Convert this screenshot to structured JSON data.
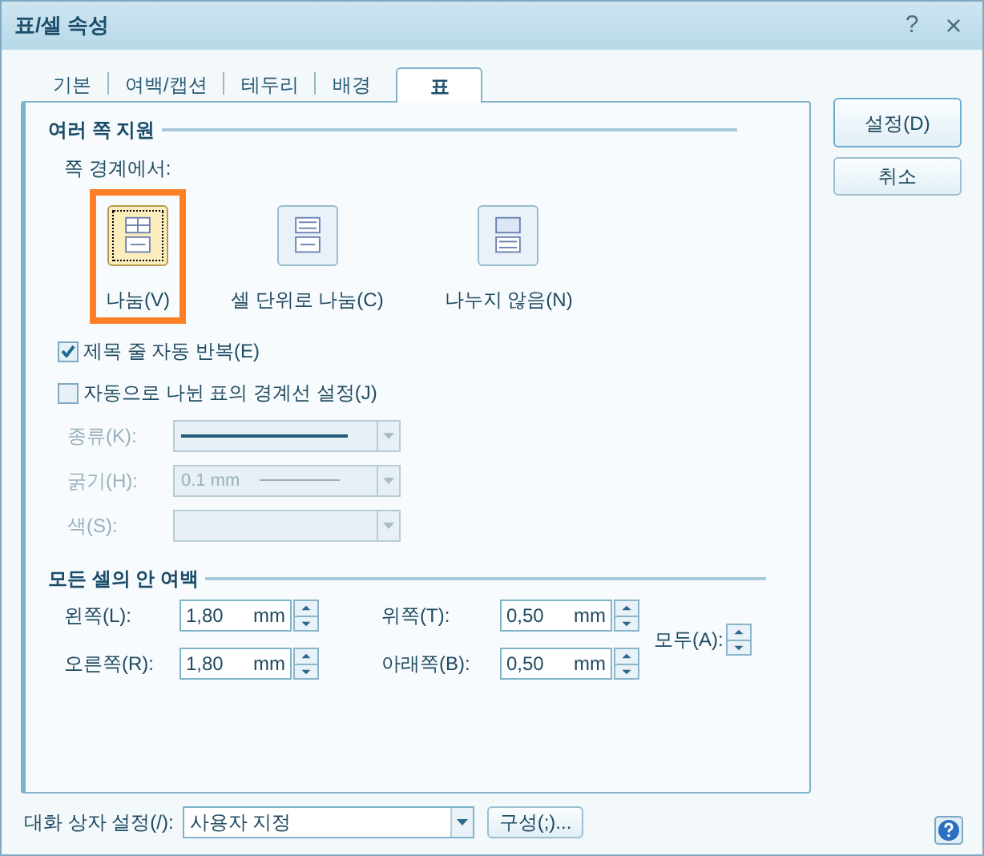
{
  "window": {
    "title": "표/셀 속성",
    "help_glyph": "?",
    "close_glyph": "×"
  },
  "tabs": [
    {
      "label": "기본",
      "selected": false
    },
    {
      "label": "여백/캡션",
      "selected": false
    },
    {
      "label": "테두리",
      "selected": false
    },
    {
      "label": "배경",
      "selected": false
    },
    {
      "label": "표",
      "selected": true
    }
  ],
  "page_split": {
    "heading": "여러 쪽 지원",
    "label": "쪽 경계에서:",
    "options": [
      {
        "kind": "split",
        "label": "나눔(V)",
        "selected": true
      },
      {
        "kind": "cell",
        "label": "셀 단위로 나눔(C)",
        "selected": false
      },
      {
        "kind": "none",
        "label": "나누지 않음(N)",
        "selected": false
      }
    ]
  },
  "checkboxes": [
    {
      "label": "제목 줄 자동 반복(E)",
      "checked": true
    },
    {
      "label": "자동으로 나뉜 표의 경계선 설정(J)",
      "checked": false
    }
  ],
  "border_settings": [
    {
      "kind": "line",
      "label": "종류(K):",
      "disabled": true
    },
    {
      "kind": "thickness",
      "label": "굵기(H):",
      "value": "0.1 mm",
      "disabled": true
    },
    {
      "kind": "color",
      "label": "색(S):",
      "disabled": true
    }
  ],
  "margins": {
    "heading": "모든 셀의 안 여백",
    "fields": [
      {
        "label": "왼쪽(L):",
        "value": "1,80",
        "unit": "mm"
      },
      {
        "label": "위쪽(T):",
        "value": "0,50",
        "unit": "mm"
      },
      {
        "label": "오른쪽(R):",
        "value": "1,80",
        "unit": "mm"
      },
      {
        "label": "아래쪽(B):",
        "value": "0,50",
        "unit": "mm"
      }
    ],
    "all_label": "모두(A):"
  },
  "buttons": [
    "설정(D)",
    "취소"
  ],
  "footer": {
    "label": "대화 상자 설정(/):",
    "value": "사용자 지정",
    "button": "구성(;)..."
  }
}
